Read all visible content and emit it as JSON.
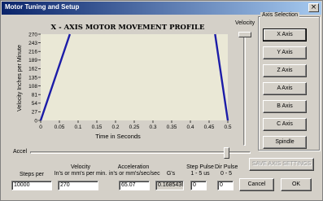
{
  "window": {
    "title": "Motor Tuning and Setup",
    "close_glyph": "×"
  },
  "chart": {
    "title": "X - AXIS MOTOR MOVEMENT PROFILE",
    "xlabel": "Time in Seconds",
    "ylabel": "Velocity Inches per Minute",
    "background": "#eae8d6",
    "line_color": "#1c1ca8"
  },
  "chart_data": {
    "type": "line",
    "title": "X - AXIS MOTOR MOVEMENT PROFILE",
    "xlabel": "Time in Seconds",
    "ylabel": "Velocity Inches per Minute",
    "xlim": [
      0,
      0.5
    ],
    "ylim": [
      0,
      270
    ],
    "x_ticks": [
      "0",
      "0.05",
      "0.1",
      "0.15",
      "0.2",
      "0.25",
      "0.3",
      "0.35",
      "0.4",
      "0.45",
      "0.5"
    ],
    "y_ticks": [
      "0",
      "27",
      "54",
      "81",
      "108",
      "135",
      "162",
      "189",
      "216",
      "243",
      "270"
    ],
    "series": [
      {
        "x": [
          0.0,
          0.078
        ],
        "values": [
          0,
          270
        ]
      },
      {
        "x": [
          0.466,
          0.5
        ],
        "values": [
          270,
          0
        ]
      }
    ],
    "grid": false
  },
  "velocity_slider": {
    "label": "Velocity"
  },
  "accel_slider": {
    "label": "Accel"
  },
  "axis_selection": {
    "label": "Axis Selection",
    "buttons": [
      "X Axis",
      "Y Axis",
      "Z Axis",
      "A Axis",
      "B Axis",
      "C Axis",
      "Spindle"
    ],
    "selected": "X Axis"
  },
  "save_axis": {
    "label": "SAVE AXIS SETTINGS"
  },
  "fields": {
    "steps_per": {
      "label": "Steps per",
      "value": "10000"
    },
    "velocity": {
      "label1": "Velocity",
      "label2": "In's or mm's per min.",
      "value": "270"
    },
    "acceleration": {
      "label1": "Acceleration",
      "label2": "in's or mm's/sec/sec",
      "value": "65.07"
    },
    "gs": {
      "label": "G's",
      "value": "0.1685436"
    },
    "step_pulse": {
      "label1": "Step Pulse",
      "label2": "1 - 5 us",
      "value": "0"
    },
    "dir_pulse": {
      "label1": "Dir Pulse",
      "label2": "0 - 5",
      "value": "0"
    }
  },
  "buttons": {
    "cancel": "Cancel",
    "ok": "OK"
  }
}
